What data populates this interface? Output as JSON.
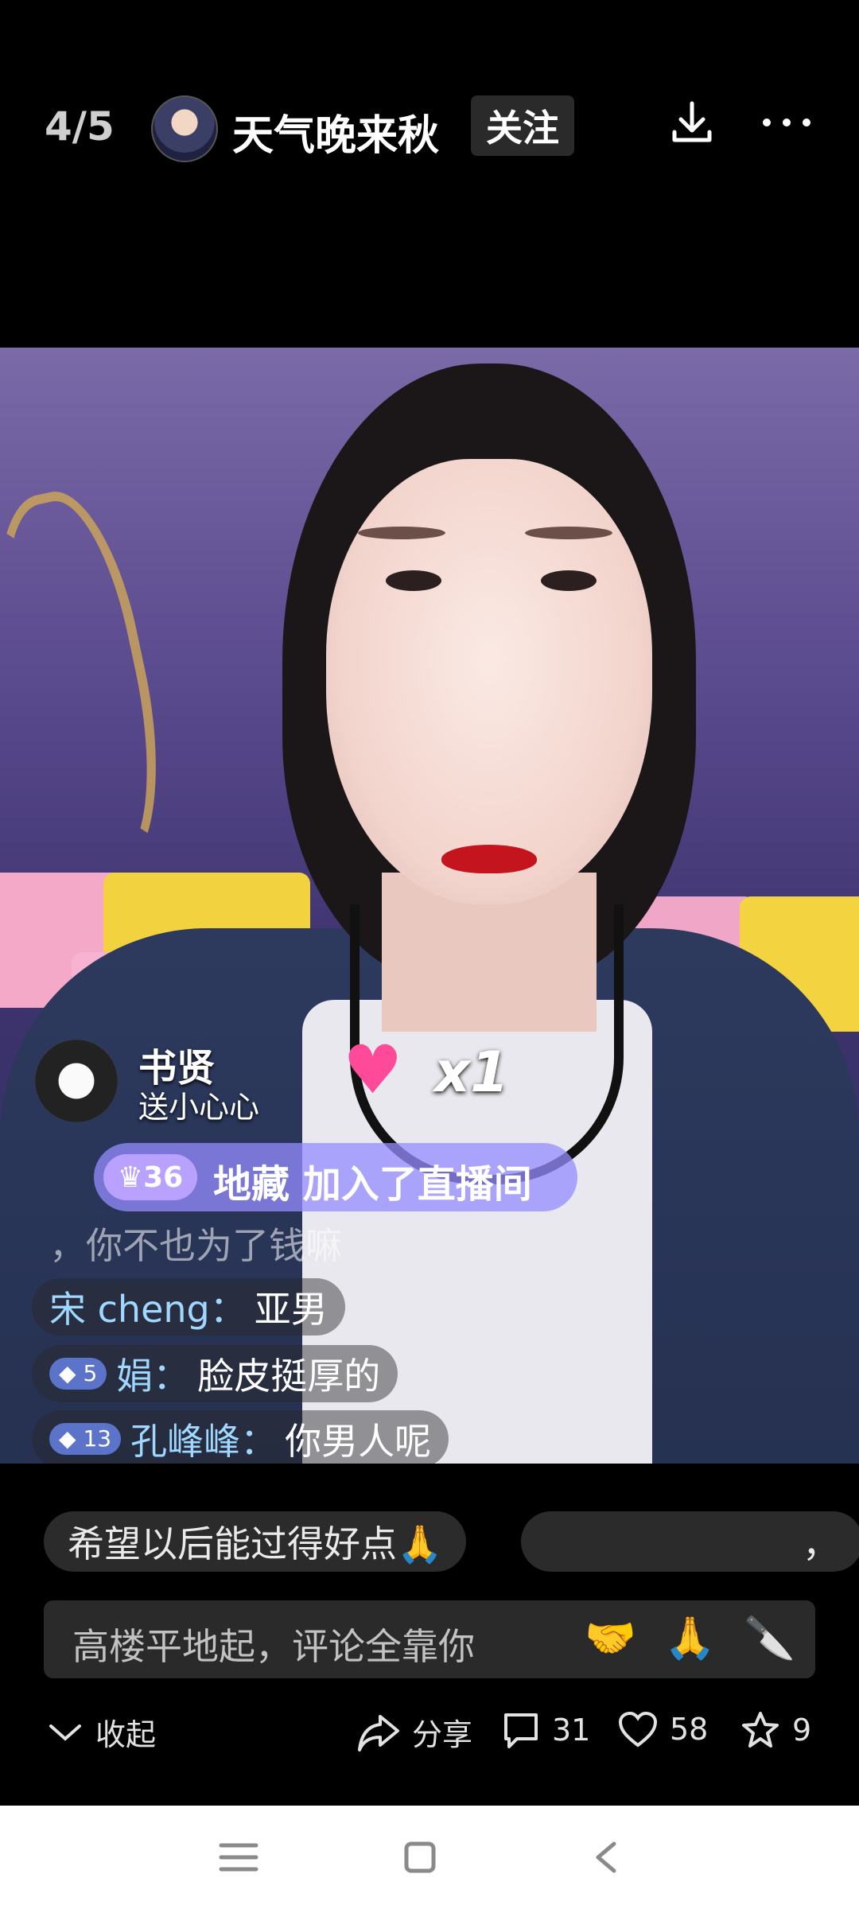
{
  "header": {
    "counter": "4/5",
    "username": "天气晚来秋",
    "follow_label": "关注",
    "icons": [
      "avatar",
      "download-icon",
      "more-icon"
    ]
  },
  "live": {
    "gift": {
      "user": "书贤",
      "action": "送小心心",
      "count": "x1",
      "icon": "heart-gift-icon"
    },
    "join": {
      "level": "36",
      "text": "地藏 加入了直播间"
    },
    "chats": [
      {
        "text": "，你不也为了钱嘛"
      },
      {
        "user": "宋 cheng：",
        "text": "亚男"
      },
      {
        "level": "5",
        "user": "娟：",
        "text": "脸皮挺厚的"
      },
      {
        "level": "13",
        "user": "孔峰峰：",
        "text": "你男人呢"
      }
    ]
  },
  "tags": [
    "希望以后能过得好点🙏",
    "，"
  ],
  "comment": {
    "placeholder": "高楼平地起，评论全靠你",
    "emojis": [
      "🤝",
      "🙏",
      "🔪"
    ]
  },
  "actions": {
    "collapse": "收起",
    "share": "分享",
    "comments": "31",
    "likes": "58",
    "favorites": "9"
  },
  "nav": [
    "menu-icon",
    "home-icon",
    "back-icon"
  ]
}
